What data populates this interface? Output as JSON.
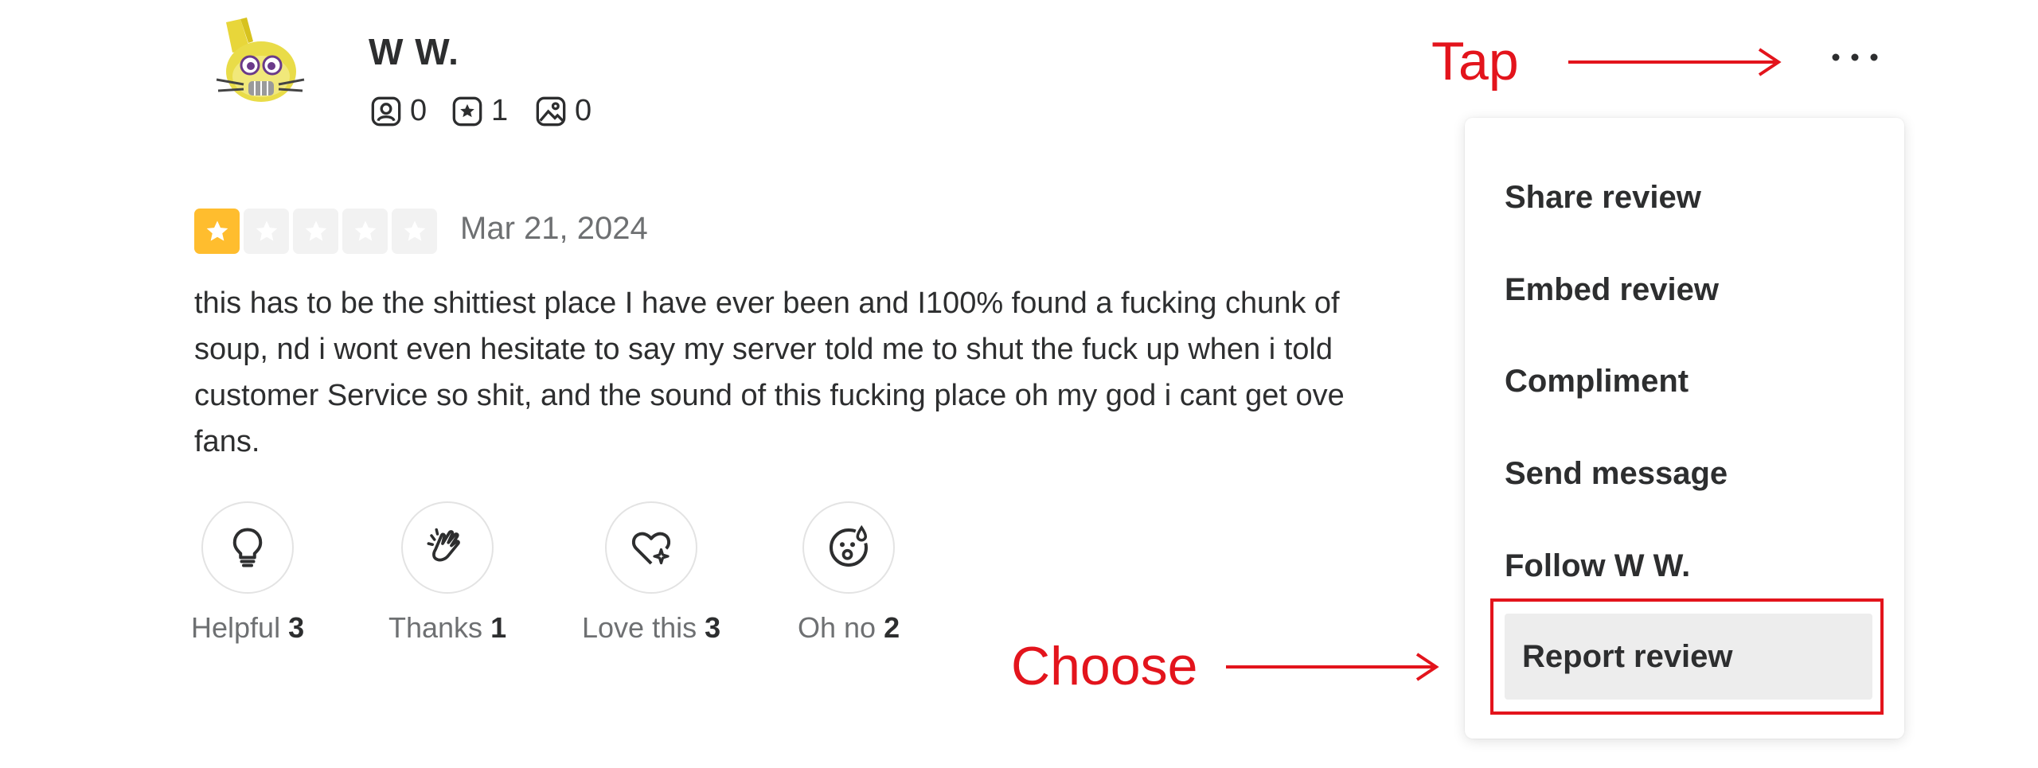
{
  "reviewer": {
    "name": "W W.",
    "avatar_icon": "cartoon-avatar",
    "stats": {
      "friends": "0",
      "reviews": "1",
      "photos": "0"
    }
  },
  "review": {
    "rating": 1,
    "rating_max": 5,
    "date": "Mar 21, 2024",
    "text_lines": [
      "this has to be the shittiest place I have ever been and I100% found a fucking chunk of",
      "soup, nd i wont even hesitate to say my server told me to shut the fuck up when i told",
      "customer Service so shit, and the sound of this fucking place oh my god i cant get ove",
      "fans."
    ]
  },
  "reactions": [
    {
      "label": "Helpful",
      "count": "3",
      "icon": "lightbulb-icon"
    },
    {
      "label": "Thanks",
      "count": "1",
      "icon": "clapping-hands-icon"
    },
    {
      "label": "Love this",
      "count": "3",
      "icon": "heart-sparkle-icon"
    },
    {
      "label": "Oh no",
      "count": "2",
      "icon": "surprised-face-icon"
    }
  ],
  "menu": {
    "items": [
      {
        "label": "Share review"
      },
      {
        "label": "Embed review"
      },
      {
        "label": "Compliment"
      },
      {
        "label": "Send message"
      },
      {
        "label": "Follow W W."
      },
      {
        "label": "Report review",
        "highlighted": true
      }
    ]
  },
  "more_button_icon": "ellipsis-icon",
  "annotations": {
    "tap": "Tap",
    "choose": "Choose",
    "color": "#e3141c"
  },
  "colors": {
    "star_filled": "#ffbd2e",
    "star_empty": "#f2f2f2",
    "text_primary": "#2d2e2f",
    "text_secondary": "#6e7072",
    "menu_highlight_bg": "#ededed"
  }
}
